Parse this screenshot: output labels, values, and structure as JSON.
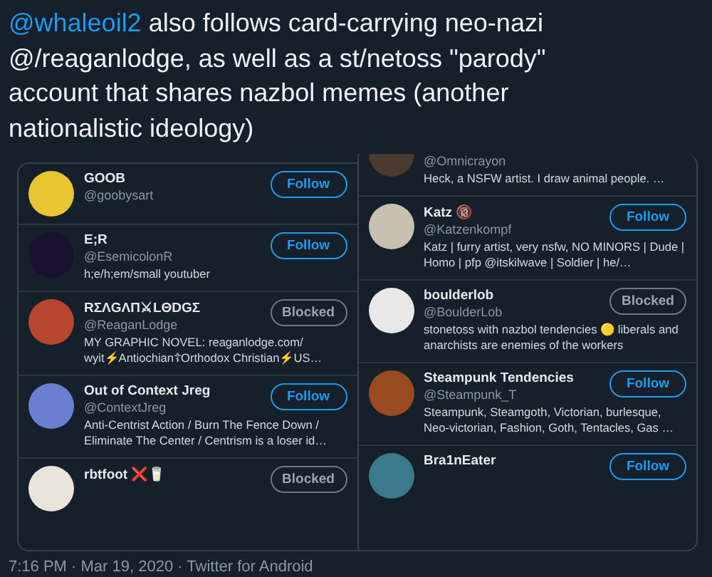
{
  "tweet": {
    "mention": "@whaleoil2",
    "text": "also follows card-carrying neo-nazi @/reaganlodge, as well as a st/netoss \"parody\" account that shares nazbol memes (another nationalistic ideology)"
  },
  "panels": [
    {
      "accounts": [
        {
          "kind": "full",
          "name": "GOOB",
          "handle": "@goobysart",
          "button": {
            "label": "Follow",
            "kind": "follow"
          },
          "color": "#e8c531"
        },
        {
          "kind": "full",
          "name": "E;R",
          "handle": "@EsemicolonR",
          "bio": "h;e/h;em/small youtuber",
          "button": {
            "label": "Follow",
            "kind": "follow"
          },
          "color": "#1a1030"
        },
        {
          "kind": "full",
          "name": "RΣΛGΛП⚔LΘDGΣ",
          "handle": "@ReaganLodge",
          "bio": "MY GRAPHIC NOVEL: reaganlodge.com/ wyit⚡Antiochian☦Orthodox Christian⚡US…",
          "button": {
            "label": "Blocked",
            "kind": "blocked"
          },
          "color": "#b8452e"
        },
        {
          "kind": "full",
          "name": "Out of Context Jreg",
          "handle": "@ContextJreg",
          "bio": "Anti-Centrist Action / Burn The Fence Down / Eliminate The Center / Centrism is a loser id…",
          "button": {
            "label": "Follow",
            "kind": "follow"
          },
          "color": "#6a7fd0"
        },
        {
          "kind": "bottom-cut",
          "name": "rbtfoot ❌🥛",
          "button": {
            "label": "Blocked",
            "kind": "blocked"
          },
          "color": "#e8e4dc"
        }
      ]
    },
    {
      "accounts": [
        {
          "kind": "top-cut",
          "handle": "@Omnicrayon",
          "bio": "Heck, a NSFW artist. I draw animal people. …",
          "color": "#4a3a30"
        },
        {
          "kind": "full",
          "name": "Katz 🔞",
          "handle": "@Katzenkompf",
          "bio": "Katz | furry artist, very nsfw, NO MINORS | Dude | Homo | pfp @itskilwave | Soldier | he/…",
          "button": {
            "label": "Follow",
            "kind": "follow"
          },
          "color": "#c8c0b0"
        },
        {
          "kind": "full",
          "name": "boulderlob",
          "handle": "@BoulderLob",
          "bio": "stonetoss with nazbol tendencies 🟡 liberals and anarchists are enemies of the workers",
          "button": {
            "label": "Blocked",
            "kind": "blocked"
          },
          "color": "#e8e8e8"
        },
        {
          "kind": "full",
          "name": "Steampunk Tendencies",
          "handle": "@Steampunk_T",
          "bio": "Steampunk, Steamgoth, Victorian, burlesque, Neo-victorian, Fashion, Goth, Tentacles, Gas …",
          "button": {
            "label": "Follow",
            "kind": "follow"
          },
          "color": "#9a4a20"
        },
        {
          "kind": "bottom-cut",
          "name": "Bra1nEater",
          "button": {
            "label": "Follow",
            "kind": "follow"
          },
          "color": "#3a7a8a"
        }
      ]
    }
  ],
  "footer": "7:16 PM · Mar 19, 2020 · Twitter for Android"
}
